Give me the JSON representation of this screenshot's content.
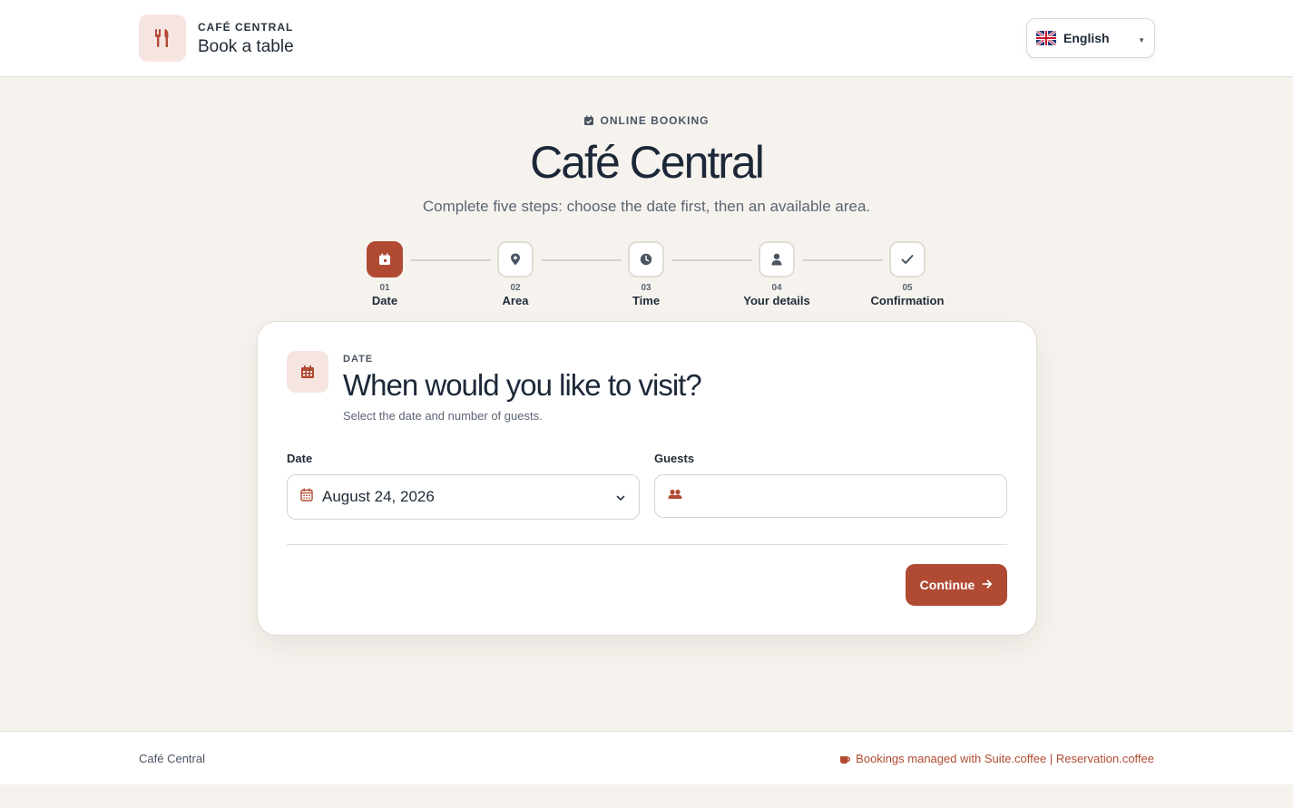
{
  "header": {
    "eyebrow": "CAFÉ CENTRAL",
    "title": "Book a table",
    "language": "English"
  },
  "hero": {
    "eyebrow": "ONLINE BOOKING",
    "title": "Café Central",
    "subtitle": "Complete five steps: choose the date first, then an available area."
  },
  "steps": [
    {
      "num": "01",
      "label": "Date",
      "icon": "calendar-icon",
      "active": true
    },
    {
      "num": "02",
      "label": "Area",
      "icon": "map-pin-icon",
      "active": false
    },
    {
      "num": "03",
      "label": "Time",
      "icon": "clock-icon",
      "active": false
    },
    {
      "num": "04",
      "label": "Your details",
      "icon": "user-icon",
      "active": false
    },
    {
      "num": "05",
      "label": "Confirmation",
      "icon": "check-icon",
      "active": false
    }
  ],
  "card": {
    "eyebrow": "DATE",
    "title": "When would you like to visit?",
    "subtitle": "Select the date and number of guests.",
    "date_label": "Date",
    "date_value": "August 24, 2026",
    "guests_label": "Guests",
    "guests_value": "",
    "continue_label": "Continue"
  },
  "footer": {
    "left": "Café Central",
    "right": "Bookings managed with Suite.coffee | Reservation.coffee"
  },
  "colors": {
    "accent": "#b14a33",
    "accent_soft": "#f6e4e0",
    "background": "#f6f3ee"
  }
}
